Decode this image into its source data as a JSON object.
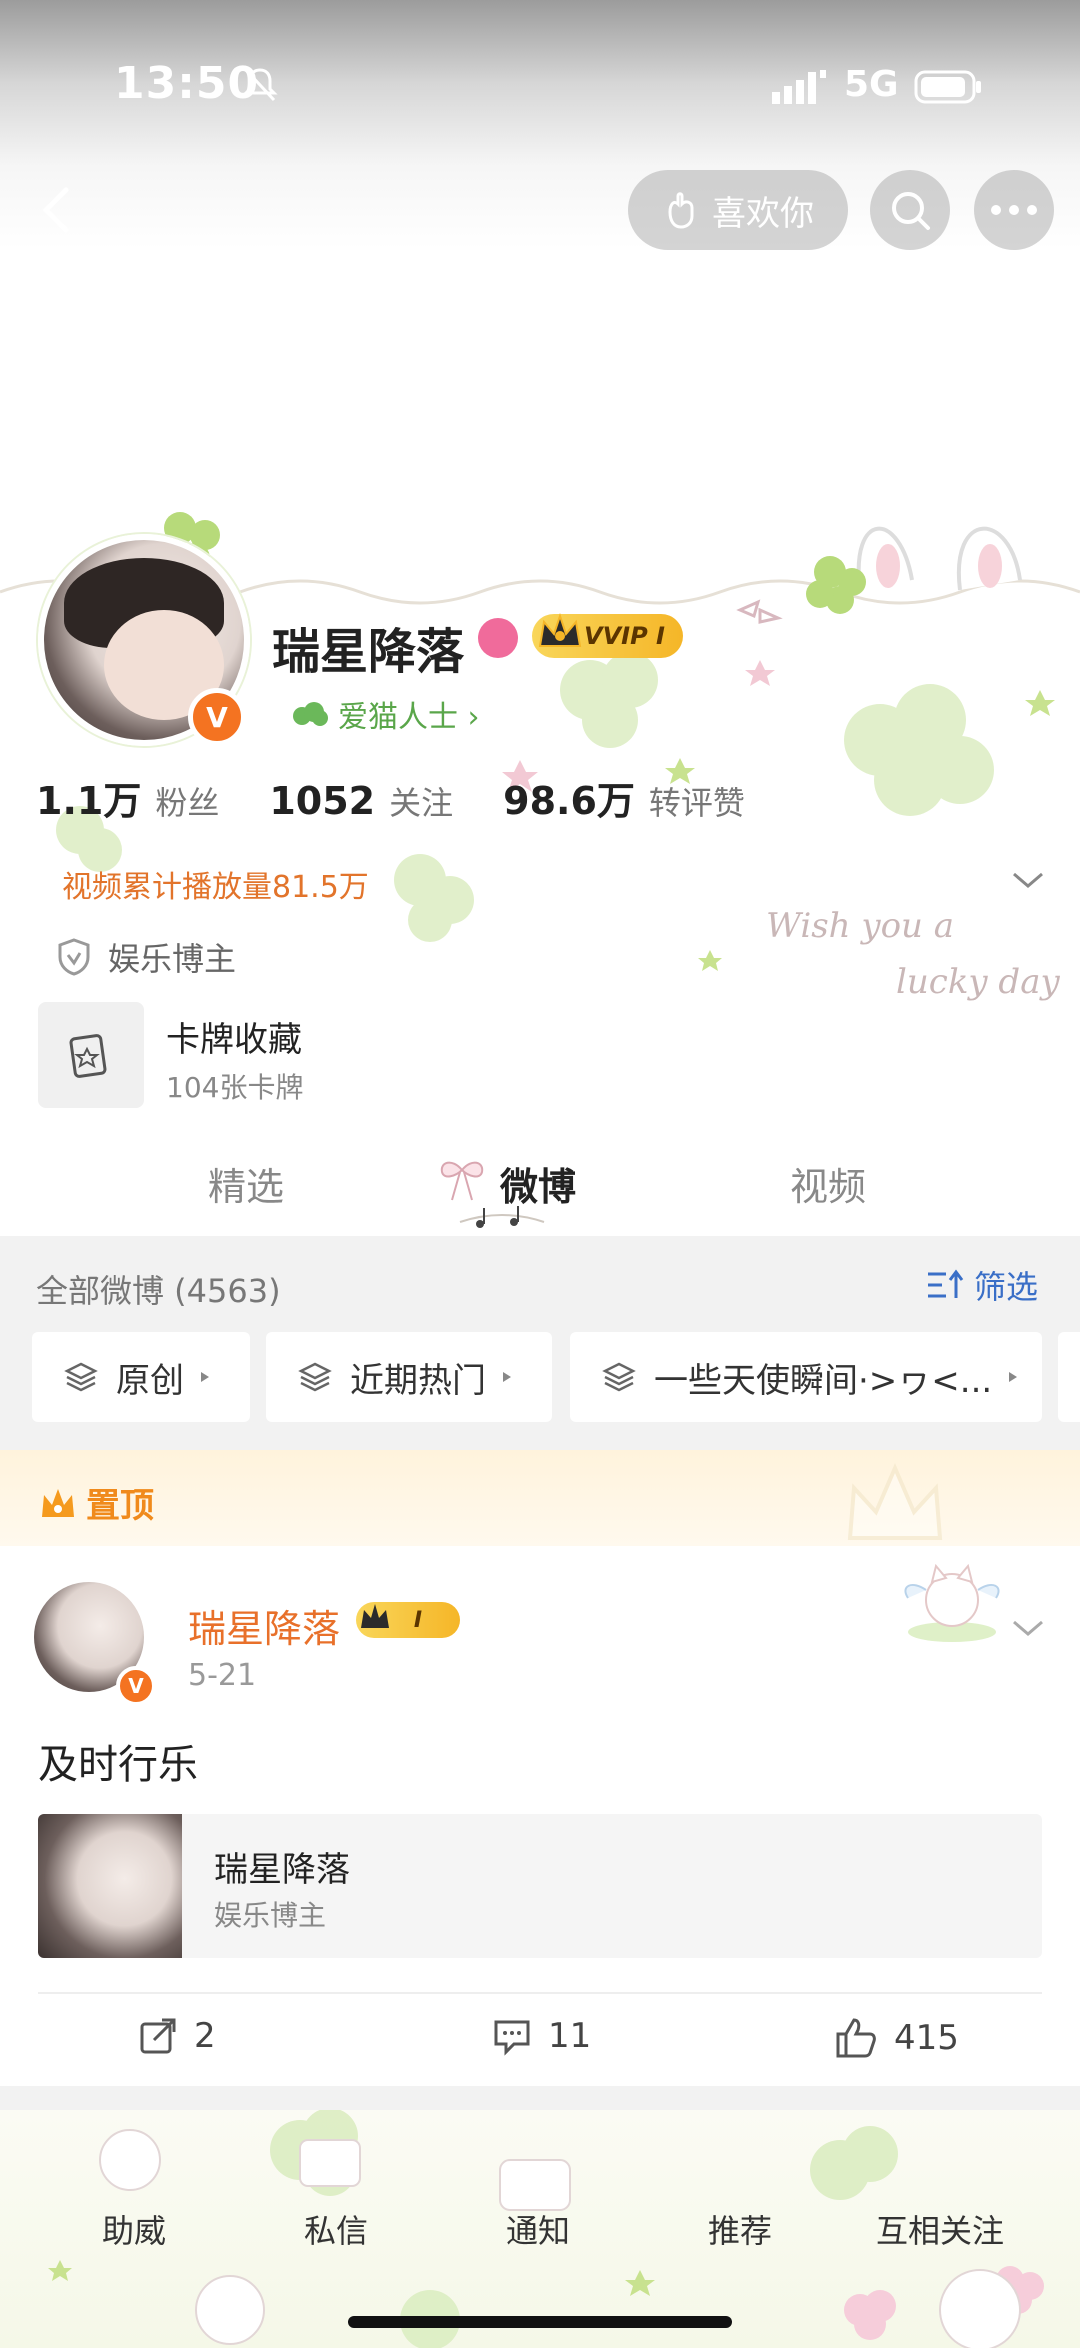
{
  "status_bar": {
    "time": "13:50",
    "network": "5G"
  },
  "top_nav": {
    "like_label": "喜欢你"
  },
  "profile": {
    "name": "瑞星降落",
    "vip_label": "VVIP I",
    "verified_mark": "V",
    "tag": "爱猫人士 ›",
    "stats": [
      {
        "value": "1.1万",
        "label": "粉丝"
      },
      {
        "value": "1052",
        "label": "关注"
      },
      {
        "value": "98.6万",
        "label": "转评赞"
      }
    ],
    "video_plays": "视频累计播放量81.5万",
    "deco_text_line1": "Wish you a",
    "deco_text_line2": "lucky day",
    "blogger_type": "娱乐博主",
    "card": {
      "title": "卡牌收藏",
      "subtitle": "104张卡牌"
    }
  },
  "tabs": [
    {
      "label": "精选"
    },
    {
      "label": "微博"
    },
    {
      "label": "视频"
    }
  ],
  "filter": {
    "all_label": "全部微博 (4563)",
    "filter_label": "筛选",
    "chips": [
      "原创",
      "近期热门",
      "一些天使瞬间·>ヮ<..."
    ]
  },
  "pinned": {
    "label": "置顶",
    "author": "瑞星降落",
    "vip_label": "I",
    "date": "5-21",
    "text": "及时行乐",
    "share": {
      "title": "瑞星降落",
      "subtitle": "娱乐博主"
    },
    "actions": {
      "reposts": "2",
      "comments": "11",
      "likes": "415"
    }
  },
  "bottom_bar": [
    "助威",
    "私信",
    "通知",
    "推荐",
    "互相关注"
  ],
  "colors": {
    "accent_orange": "#f08a1c",
    "link_blue": "#3a6fc7",
    "verified": "#f47321",
    "tag_green": "#5aa64a"
  }
}
